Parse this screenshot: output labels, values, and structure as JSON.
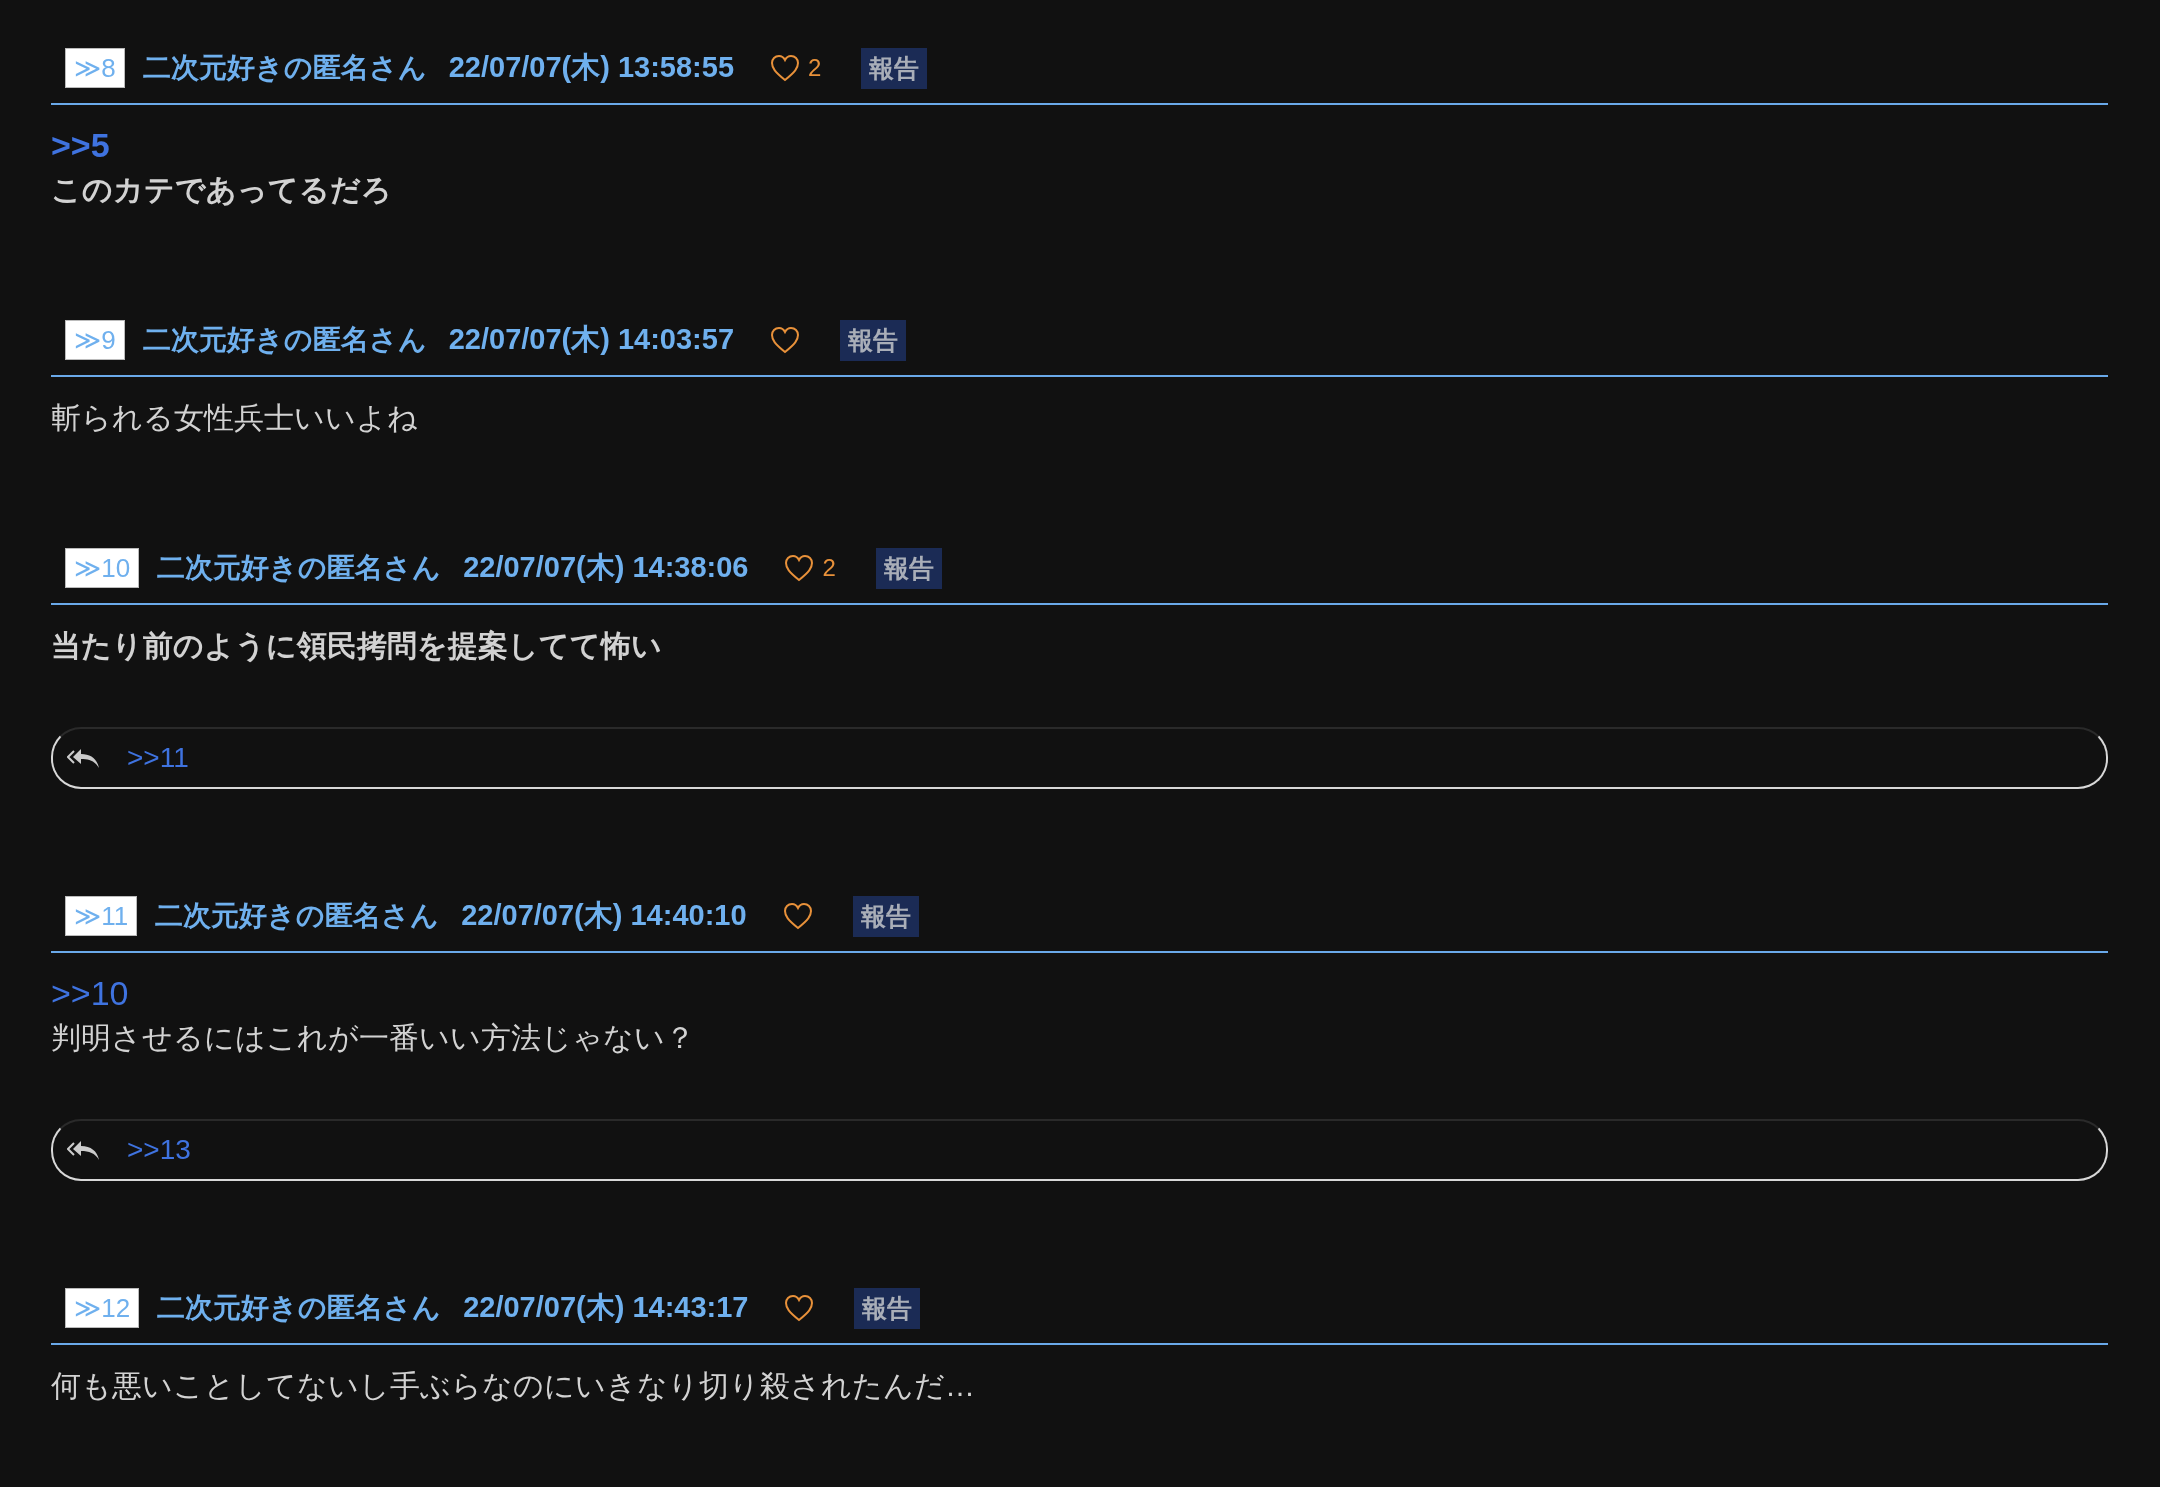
{
  "posts": [
    {
      "number": "≫8",
      "name": "二次元好きの匿名さん",
      "date": "22/07/07(木) 13:58:55",
      "likes": "2",
      "report": "報告",
      "anchor": ">>5",
      "anchor_bold": true,
      "body": "このカテであってるだろ",
      "bold": true
    },
    {
      "number": "≫9",
      "name": "二次元好きの匿名さん",
      "date": "22/07/07(木) 14:03:57",
      "report": "報告",
      "body": "斬られる女性兵士いいよね",
      "bold": false
    },
    {
      "number": "≫10",
      "name": "二次元好きの匿名さん",
      "date": "22/07/07(木) 14:38:06",
      "likes": "2",
      "report": "報告",
      "body": "当たり前のように領民拷問を提案してて怖い",
      "bold": true,
      "replies": ">>11"
    },
    {
      "number": "≫11",
      "name": "二次元好きの匿名さん",
      "date": "22/07/07(木) 14:40:10",
      "report": "報告",
      "anchor": ">>10",
      "anchor_bold": false,
      "body": "判明させるにはこれが一番いい方法じゃない？",
      "bold": false,
      "replies": ">>13"
    },
    {
      "number": "≫12",
      "name": "二次元好きの匿名さん",
      "date": "22/07/07(木) 14:43:17",
      "report": "報告",
      "body": "何も悪いことしてないし手ぶらなのにいきなり切り殺されたんだ…",
      "bold": false
    }
  ]
}
